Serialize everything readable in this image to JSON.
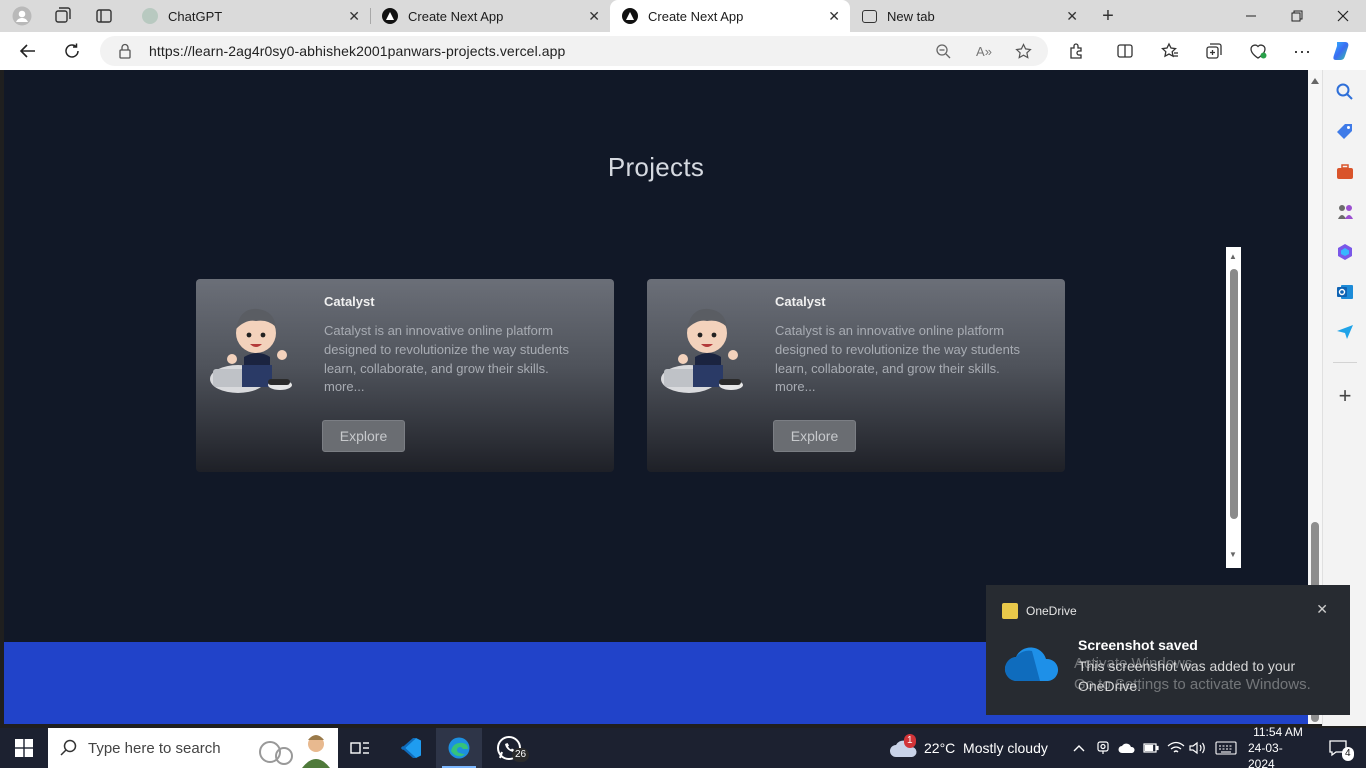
{
  "browser": {
    "tabs": [
      {
        "title": "ChatGPT",
        "icon": "chatgpt-icon",
        "active": false
      },
      {
        "title": "Create Next App",
        "icon": "triangle-icon",
        "active": false
      },
      {
        "title": "Create Next App",
        "icon": "triangle-icon",
        "active": true
      },
      {
        "title": "New tab",
        "icon": "newtab-icon",
        "active": false
      }
    ],
    "url": "https://learn-2ag4r0sy0-abhishek2001panwars-projects.vercel.app"
  },
  "page": {
    "section_title": "Projects",
    "projects": [
      {
        "title": "Catalyst",
        "description": "Catalyst is an innovative online platform designed to revolutionize the way students learn, collaborate, and grow their skills.",
        "more": "more...",
        "button": "Explore"
      },
      {
        "title": "Catalyst",
        "description": "Catalyst is an innovative online platform designed to revolutionize the way students learn, collaborate, and grow their skills.",
        "more": "more...",
        "button": "Explore"
      }
    ]
  },
  "toast": {
    "app": "OneDrive",
    "title": "Screenshot saved",
    "body": "This screenshot was added to your OneDrive.",
    "watermark": "Activate Windows\nGo to Settings to activate Windows."
  },
  "taskbar": {
    "search_placeholder": "Type here to search",
    "whatsapp_badge": "26",
    "weather_badge": "1",
    "weather": "22°C  Mostly cloudy",
    "time": "11:54 AM",
    "date": "24-03-2024",
    "notifications_badge": "4"
  },
  "colors": {
    "page_bg": "#111827",
    "footer_band": "#2143c9",
    "taskbar_bg": "#1c2130"
  }
}
